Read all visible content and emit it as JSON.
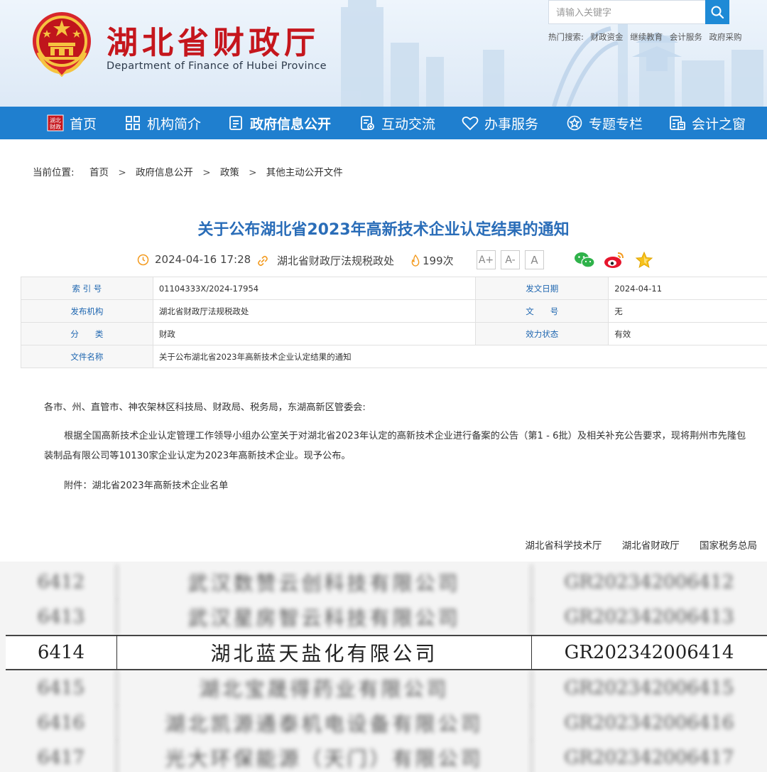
{
  "header": {
    "title": "湖北省财政厅",
    "subtitle": "Department of Finance of Hubei Province",
    "search_placeholder": "请输入关键字",
    "hot_label": "热门搜索:",
    "hot_links": [
      "财政资金",
      "继续教育",
      "会计服务",
      "政府采购"
    ]
  },
  "nav": {
    "items": [
      {
        "label": "首页",
        "icon": "home-badge-icon"
      },
      {
        "label": "机构简介",
        "icon": "grid-icon"
      },
      {
        "label": "政府信息公开",
        "icon": "document-icon"
      },
      {
        "label": "互动交流",
        "icon": "form-icon"
      },
      {
        "label": "办事服务",
        "icon": "heart-icon"
      },
      {
        "label": "专题专栏",
        "icon": "star-circle-icon"
      },
      {
        "label": "会计之窗",
        "icon": "calculator-icon"
      }
    ],
    "active_index": 2
  },
  "breadcrumb": {
    "label": "当前位置:",
    "items": [
      "首页",
      "政府信息公开",
      "政策",
      "其他主动公开文件"
    ],
    "separator": ">"
  },
  "article": {
    "title": "关于公布湖北省2023年高新技术企业认定结果的通知",
    "datetime": "2024-04-16 17:28",
    "source": "湖北省财政厅法规税政处",
    "views": "199次",
    "font_buttons": [
      "A+",
      "A-",
      "A"
    ]
  },
  "info_table": {
    "index_key": "索 引 号",
    "index_val": "01104333X/2024-17954",
    "date_key": "发文日期",
    "date_val": "2024-04-11",
    "org_key": "发布机构",
    "org_val": "湖北省财政厅法规税政处",
    "docno_key": "文　　号",
    "docno_val": "无",
    "cat_key": "分　　类",
    "cat_val": "财政",
    "status_key": "效力状态",
    "status_val": "有效",
    "name_key": "文件名称",
    "name_val": "关于公布湖北省2023年高新技术企业认定结果的通知"
  },
  "content": {
    "salutation": "各市、州、直管市、神农架林区科技局、财政局、税务局，东湖高新区管委会:",
    "paragraph": "根据全国高新技术企业认定管理工作领导小组办公室关于对湖北省2023年认定的高新技术企业进行备案的公告（第1 - 6批）及相关补充公告要求，现将荆州市先隆包装制品有限公司等10130家企业认定为2023年高新技术企业。现予公布。",
    "attachment": "附件：湖北省2023年高新技术企业名单"
  },
  "issuers": [
    "湖北省科学技术厅",
    "湖北省财政厅",
    "国家税务总局"
  ],
  "company_list": [
    {
      "no": "6412",
      "name": "武汉数赞云创科技有限公司",
      "code": "GR202342006412",
      "highlight": false
    },
    {
      "no": "6413",
      "name": "武汉星房智云科技有限公司",
      "code": "GR202342006413",
      "highlight": false
    },
    {
      "no": "6414",
      "name": "湖北蓝天盐化有限公司",
      "code": "GR202342006414",
      "highlight": true
    },
    {
      "no": "6415",
      "name": "湖北宝晟得药业有限公司",
      "code": "GR202342006415",
      "highlight": false
    },
    {
      "no": "6416",
      "name": "湖北凯源通泰机电设备有限公司",
      "code": "GR202342006416",
      "highlight": false
    },
    {
      "no": "6417",
      "name": "光大环保能源（天门）有限公司",
      "code": "GR202342006417",
      "highlight": false
    }
  ],
  "colors": {
    "brand_red": "#c5161d",
    "nav_blue": "#1f7fcf",
    "title_blue": "#2a6db8",
    "table_key_blue": "#1e66b0",
    "meta_orange": "#f39a1e"
  }
}
